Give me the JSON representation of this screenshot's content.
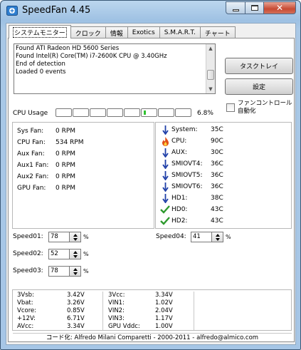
{
  "window": {
    "title": "SpeedFan 4.45"
  },
  "tabs": [
    {
      "label": "システムモニター",
      "active": true
    },
    {
      "label": "クロック"
    },
    {
      "label": "情報"
    },
    {
      "label": "Exotics"
    },
    {
      "label": "S.M.A.R.T."
    },
    {
      "label": "チャート"
    }
  ],
  "log": {
    "lines": [
      "Found ATI Radeon HD 5600 Series",
      "Found Intel(R) Core(TM) i7-2600K CPU @ 3.40GHz",
      "End of detection",
      "Loaded 0 events"
    ]
  },
  "buttons": {
    "tray": "タスクトレイ",
    "settings": "設定"
  },
  "auto_fan_control": {
    "label": "ファンコントロール自動化",
    "checked": false
  },
  "cpu_usage": {
    "label": "CPU Usage",
    "percent_text": "6.8%",
    "bars": 8,
    "active_bar": 5
  },
  "fans": [
    {
      "name": "Sys Fan:",
      "value": "0 RPM"
    },
    {
      "name": "CPU Fan:",
      "value": "534 RPM"
    },
    {
      "name": "Aux Fan:",
      "value": "0 RPM"
    },
    {
      "name": "Aux1 Fan:",
      "value": "0 RPM"
    },
    {
      "name": "Aux2 Fan:",
      "value": "0 RPM"
    },
    {
      "name": "GPU Fan:",
      "value": "0 RPM"
    }
  ],
  "temps": [
    {
      "name": "System:",
      "value": "35C",
      "icon": "arrow-down-icon"
    },
    {
      "name": "CPU:",
      "value": "90C",
      "icon": "flame-icon"
    },
    {
      "name": "AUX:",
      "value": "30C",
      "icon": "arrow-down-icon"
    },
    {
      "name": "SMIOVT4:",
      "value": "36C",
      "icon": "arrow-down-icon"
    },
    {
      "name": "SMIOVT5:",
      "value": "36C",
      "icon": "arrow-down-icon"
    },
    {
      "name": "SMIOVT6:",
      "value": "36C",
      "icon": "arrow-down-icon"
    },
    {
      "name": "HD1:",
      "value": "38C",
      "icon": "arrow-down-icon"
    },
    {
      "name": "HD0:",
      "value": "43C",
      "icon": "checkmark-icon"
    },
    {
      "name": "HD2:",
      "value": "43C",
      "icon": "checkmark-icon"
    }
  ],
  "speeds": [
    {
      "label": "Speed01:",
      "value": "78"
    },
    {
      "label": "Speed02:",
      "value": "52"
    },
    {
      "label": "Speed03:",
      "value": "78"
    },
    {
      "label": "Speed04:",
      "value": "41"
    }
  ],
  "speed_unit": "%",
  "voltages": [
    {
      "name": "3Vsb:",
      "value": "3.42V"
    },
    {
      "name": "Vbat:",
      "value": "3.26V"
    },
    {
      "name": "Vcore:",
      "value": "0.85V"
    },
    {
      "name": "+12V:",
      "value": "6.71V"
    },
    {
      "name": "AVcc:",
      "value": "3.34V"
    },
    {
      "name": "3Vcc:",
      "value": "3.34V"
    },
    {
      "name": "VIN1:",
      "value": "1.02V"
    },
    {
      "name": "VIN2:",
      "value": "2.04V"
    },
    {
      "name": "VIN3:",
      "value": "1.17V"
    },
    {
      "name": "GPU Vddc:",
      "value": "1.00V"
    }
  ],
  "footer": "コード化: Alfredo Milani Comparetti - 2000-2011 - alfredo@almico.com",
  "colors": {
    "arrow": "#1f3fa8",
    "check": "#2e9a2e",
    "flame": "#e0501a",
    "cpu_bar": "#31c231"
  }
}
